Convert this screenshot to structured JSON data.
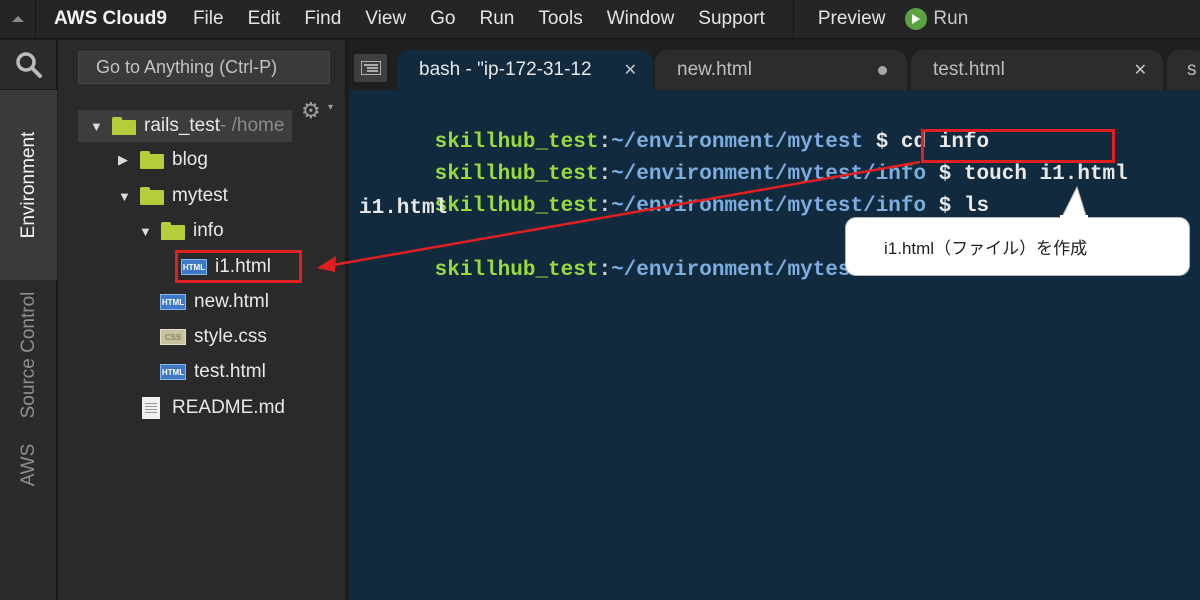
{
  "menubar": {
    "brand": "AWS Cloud9",
    "items": [
      "File",
      "Edit",
      "Find",
      "View",
      "Go",
      "Run",
      "Tools",
      "Window",
      "Support"
    ],
    "preview": "Preview",
    "run": "Run"
  },
  "sidebar_tabs": {
    "environment": "Environment",
    "source_control": "Source Control",
    "aws": "AWS"
  },
  "tree": {
    "goto_placeholder": "Go to Anything (Ctrl-P)",
    "root_name": "rails_test",
    "root_path": " - /home",
    "blog": "blog",
    "mytest": "mytest",
    "info": "info",
    "i1": "i1.html",
    "new": "new.html",
    "style": "style.css",
    "test": "test.html",
    "readme": "README.md"
  },
  "tabs": {
    "bash": "bash - \"ip-172-31-12",
    "new": "new.html",
    "test": "test.html",
    "overflow": "s"
  },
  "terminal": {
    "user": "skillhub_test",
    "lines": [
      {
        "path": "~/environment/mytest",
        "cmd": " $ cd info"
      },
      {
        "path": "~/environment/mytest/info",
        "cmd": " $ touch i1.html"
      },
      {
        "path": "~/environment/mytest/info",
        "cmd": " $ ls"
      }
    ],
    "output": "i1.html",
    "last_path": "~/environment/mytest/i"
  },
  "annotation": {
    "callout": "i1.html（ファイル）を作成",
    "highlight_color": "#e02020"
  },
  "icons": {
    "file_html": "HTML",
    "file_css": "CSS"
  }
}
